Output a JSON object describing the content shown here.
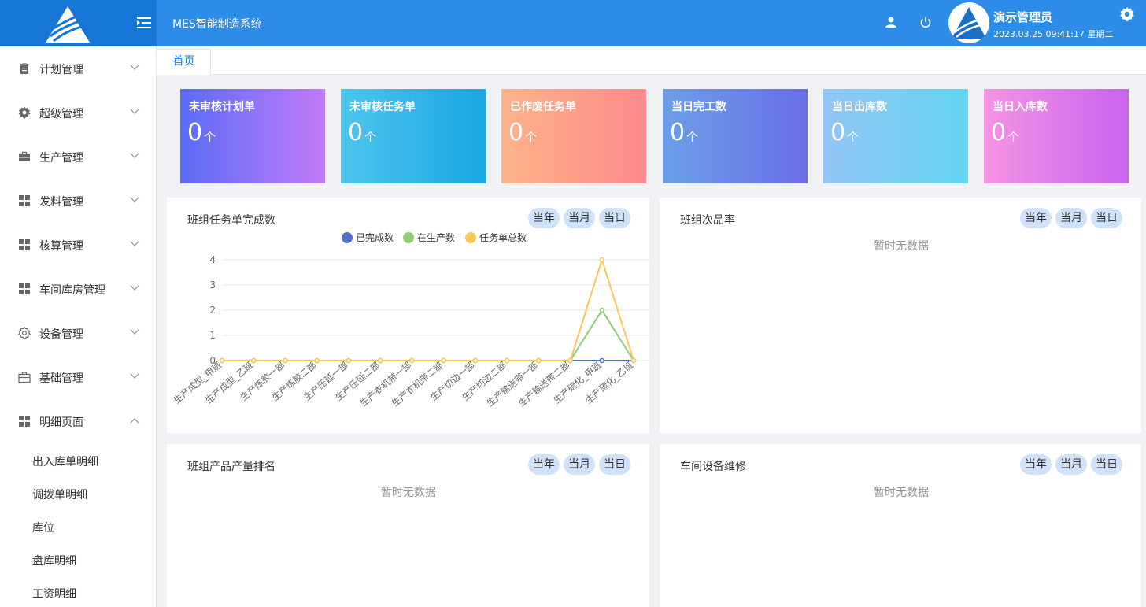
{
  "header": {
    "title": "MES智能制造系统",
    "user_name": "演示管理员",
    "datetime": "2023.03.25 09:41:17 星期二"
  },
  "sidebar": {
    "items": [
      {
        "label": "计划管理",
        "icon": "clipboard-icon"
      },
      {
        "label": "超级管理",
        "icon": "gear-icon"
      },
      {
        "label": "生产管理",
        "icon": "briefcase-icon"
      },
      {
        "label": "发料管理",
        "icon": "grid-icon"
      },
      {
        "label": "核算管理",
        "icon": "grid-icon"
      },
      {
        "label": "车间库房管理",
        "icon": "grid-icon"
      },
      {
        "label": "设备管理",
        "icon": "gear-outline-icon"
      },
      {
        "label": "基础管理",
        "icon": "suitcase-icon"
      },
      {
        "label": "明细页面",
        "icon": "grid-icon"
      }
    ],
    "sub_items": [
      "出入库单明细",
      "调拨单明细",
      "库位",
      "盘库明细",
      "工资明细"
    ]
  },
  "tabs": [
    "首页"
  ],
  "cards": [
    {
      "title": "未审核计划单",
      "value": "0",
      "unit": "个",
      "colors": [
        "#5b6cf6",
        "#c27bf9"
      ]
    },
    {
      "title": "未审核任务单",
      "value": "0",
      "unit": "个",
      "colors": [
        "#4dc6ed",
        "#1aa6e2"
      ]
    },
    {
      "title": "已作废任务单",
      "value": "0",
      "unit": "个",
      "colors": [
        "#fdb389",
        "#fd8a8c"
      ]
    },
    {
      "title": "当日完工数",
      "value": "0",
      "unit": "个",
      "colors": [
        "#6c9fe8",
        "#6a6ee6"
      ]
    },
    {
      "title": "当日出库数",
      "value": "0",
      "unit": "个",
      "colors": [
        "#94c5f7",
        "#63d6f1"
      ]
    },
    {
      "title": "当日入库数",
      "value": "0",
      "unit": "个",
      "colors": [
        "#f594e4",
        "#c964f0"
      ]
    }
  ],
  "panels": [
    {
      "title": "班组任务单完成数",
      "buttons": [
        "当年",
        "当月",
        "当日"
      ]
    },
    {
      "title": "班组次品率",
      "buttons": [
        "当年",
        "当月",
        "当日"
      ],
      "no_data": "暂时无数据"
    },
    {
      "title": "班组产品产量排名",
      "buttons": [
        "当年",
        "当月",
        "当日"
      ],
      "no_data": "暂时无数据"
    },
    {
      "title": "车间设备维修",
      "buttons": [
        "当年",
        "当月",
        "当日"
      ],
      "no_data": "暂时无数据"
    }
  ],
  "chart_data": {
    "type": "line",
    "categories": [
      "生产成型_甲班",
      "生产成型_乙班",
      "生产炼胶一部",
      "生产炼胶二部",
      "生产压延一部",
      "生产压延二部",
      "生产衣机带一部",
      "生产衣机带二部",
      "生产切边一部",
      "生产切边二部",
      "生产输送带一部",
      "生产输送带二部",
      "生产硫化_甲班",
      "生产硫化_乙班"
    ],
    "series": [
      {
        "name": "已完成数",
        "color": "#5470c6",
        "values": [
          0,
          0,
          0,
          0,
          0,
          0,
          0,
          0,
          0,
          0,
          0,
          0,
          0,
          0
        ]
      },
      {
        "name": "在生产数",
        "color": "#91cc75",
        "values": [
          0,
          0,
          0,
          0,
          0,
          0,
          0,
          0,
          0,
          0,
          0,
          0,
          2,
          0
        ]
      },
      {
        "name": "任务单总数",
        "color": "#fac858",
        "values": [
          0,
          0,
          0,
          0,
          0,
          0,
          0,
          0,
          0,
          0,
          0,
          0,
          4,
          0
        ]
      }
    ],
    "y_ticks": [
      "0",
      "1",
      "2",
      "3",
      "4"
    ],
    "ylim": [
      0,
      4
    ],
    "legend_position": "top-center",
    "grid": true
  }
}
